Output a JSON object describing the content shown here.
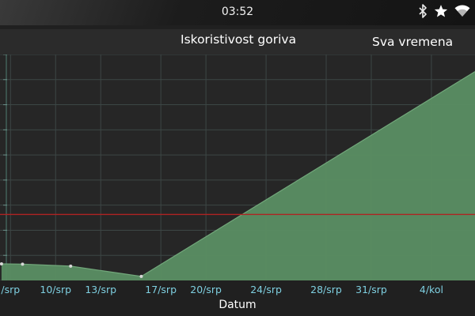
{
  "status_bar": {
    "time": "03:52",
    "icons": [
      "bluetooth-icon",
      "star-icon",
      "wifi-icon"
    ]
  },
  "header": {
    "title": "Iskoristivost goriva",
    "period_label": "Sva vremena"
  },
  "chart_data": {
    "type": "area",
    "title": "Iskoristivost goriva",
    "xlabel": "Datum",
    "ylabel": "",
    "x_ticks": [
      {
        "day": 7,
        "label": "/srp"
      },
      {
        "day": 10,
        "label": "10/srp"
      },
      {
        "day": 13,
        "label": "13/srp"
      },
      {
        "day": 17,
        "label": "17/srp"
      },
      {
        "day": 20,
        "label": "20/srp"
      },
      {
        "day": 24,
        "label": "24/srp"
      },
      {
        "day": 28,
        "label": "28/srp"
      },
      {
        "day": 31,
        "label": "31/srp"
      },
      {
        "day": 35,
        "label": "4/kol"
      }
    ],
    "xlim": [
      6.3,
      37.9
    ],
    "series": [
      {
        "points": [
          {
            "x": 6.4,
            "y": 6.6
          },
          {
            "x": 7.8,
            "y": 6.5
          },
          {
            "x": 11.0,
            "y": 5.7
          },
          {
            "x": 15.7,
            "y": 1.6
          },
          {
            "x": 37.9,
            "y": 83.2
          }
        ]
      }
    ],
    "reference_line": {
      "y": 26.3,
      "color": "#b02222"
    },
    "ylim": [
      0,
      90
    ],
    "grid": true,
    "colors": {
      "area_fill": "#5a8e63",
      "area_line": "#72a87b",
      "point": "#d8d8d8",
      "grid": "#3c4645",
      "tick_label": "#7ecfe0"
    }
  }
}
